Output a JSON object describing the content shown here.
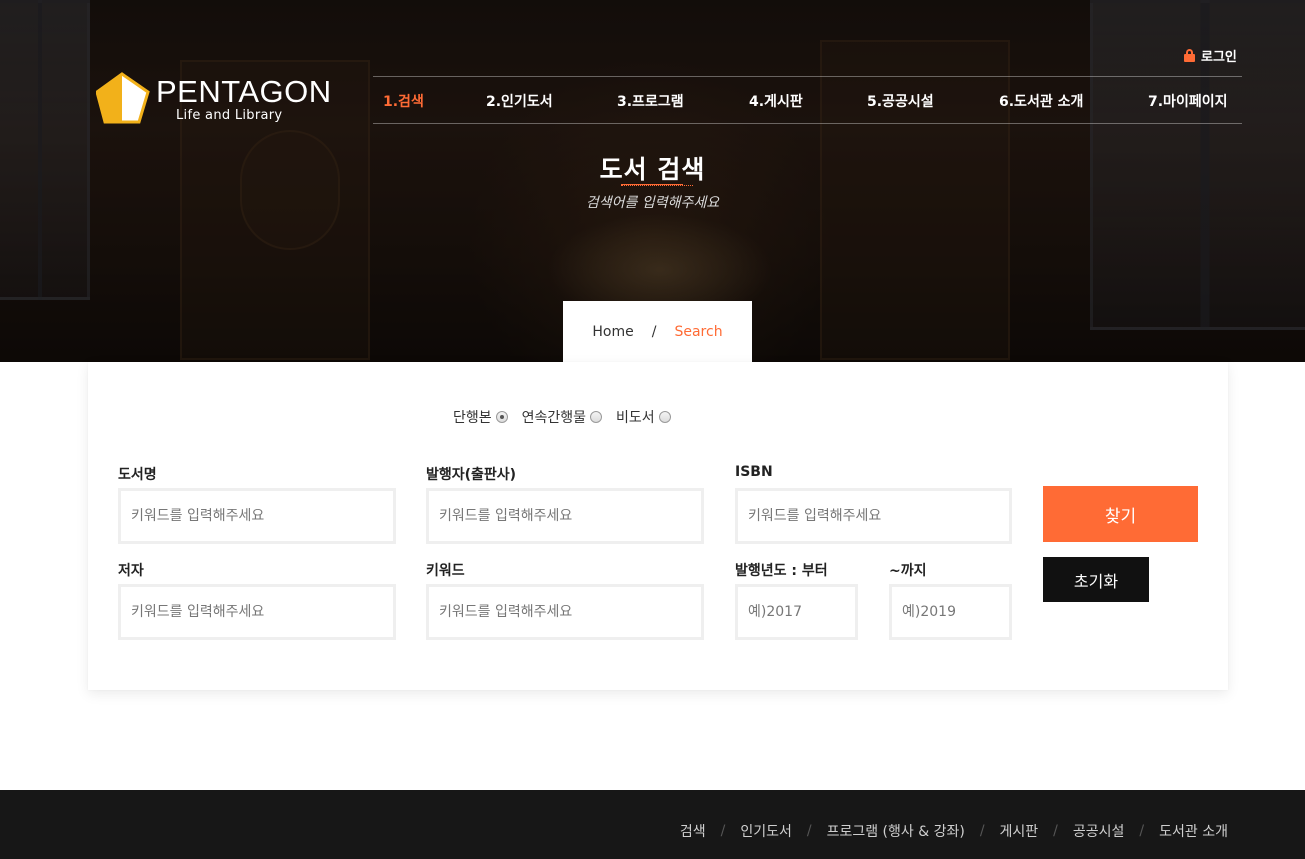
{
  "brand": {
    "name": "PENTAGON",
    "tagline": "Life and Library"
  },
  "header": {
    "login_label": "로그인",
    "nav": [
      {
        "label": "1.검색",
        "active": true
      },
      {
        "label": "2.인기도서",
        "active": false
      },
      {
        "label": "3.프로그램",
        "active": false
      },
      {
        "label": "4.게시판",
        "active": false
      },
      {
        "label": "5.공공시설",
        "active": false
      },
      {
        "label": "6.도서관 소개",
        "active": false
      },
      {
        "label": "7.마이페이지",
        "active": false
      }
    ]
  },
  "hero": {
    "title": "도서 검색",
    "subtitle": "검색어를 입력해주세요",
    "breadcrumb": {
      "home": "Home",
      "separator": "/",
      "current": "Search"
    }
  },
  "search": {
    "radios": [
      {
        "label": "단행본",
        "checked": true
      },
      {
        "label": "연속간행물",
        "checked": false
      },
      {
        "label": "비도서",
        "checked": false
      }
    ],
    "fields": {
      "title": {
        "label": "도서명",
        "value": "",
        "placeholder": "키워드를 입력해주세요"
      },
      "publisher": {
        "label": "발행자(출판사)",
        "value": "",
        "placeholder": "키워드를 입력해주세요"
      },
      "isbn": {
        "label": "ISBN",
        "value": "",
        "placeholder": "키워드를 입력해주세요"
      },
      "author": {
        "label": "저자",
        "value": "",
        "placeholder": "키워드를 입력해주세요"
      },
      "keyword": {
        "label": "키워드",
        "value": "",
        "placeholder": "키워드를 입력해주세요"
      },
      "year_from": {
        "label": "발행년도 : 부터",
        "value": "",
        "placeholder": "예)2017"
      },
      "year_to": {
        "label": "~까지",
        "value": "",
        "placeholder": "예)2019"
      }
    },
    "search_button": "찾기",
    "reset_button": "초기화"
  },
  "footer": {
    "separator": "/",
    "links": [
      "검색",
      "인기도서",
      "프로그램 (행사 & 강좌)",
      "게시판",
      "공공시설",
      "도서관 소개"
    ]
  },
  "colors": {
    "accent": "#ff6b35",
    "dark": "#171717",
    "button_dark": "#111111"
  }
}
